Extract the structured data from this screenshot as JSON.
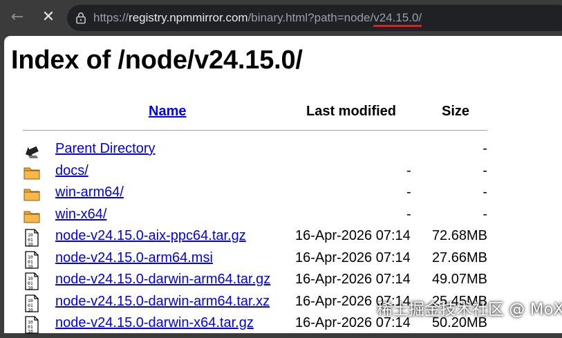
{
  "browser": {
    "back_icon": "arrow-left-icon",
    "stop_icon": "close-icon",
    "url": {
      "scheme": "https://",
      "host": "registry.npmmirror.com",
      "path": "/binary.html?path=node/",
      "highlight": "v24.15.0/"
    },
    "highlight_color": "#e02020"
  },
  "page": {
    "title": "Index of /node/v24.15.0/",
    "columns": {
      "name": "Name",
      "modified": "Last modified",
      "size": "Size"
    },
    "link_color": "#0000ee",
    "rows": [
      {
        "icon": "parent-directory-icon",
        "name": "Parent Directory",
        "modified": "",
        "size": "-"
      },
      {
        "icon": "folder-icon",
        "name": "docs/",
        "modified": "-",
        "size": "-"
      },
      {
        "icon": "folder-icon",
        "name": "win-arm64/",
        "modified": "-",
        "size": "-"
      },
      {
        "icon": "folder-icon",
        "name": "win-x64/",
        "modified": "-",
        "size": "-"
      },
      {
        "icon": "binary-file-icon",
        "name": "node-v24.15.0-aix-ppc64.tar.gz",
        "modified": "16-Apr-2026 07:14",
        "size": "72.68MB"
      },
      {
        "icon": "binary-file-icon",
        "name": "node-v24.15.0-arm64.msi",
        "modified": "16-Apr-2026 07:14",
        "size": "27.66MB"
      },
      {
        "icon": "binary-file-icon",
        "name": "node-v24.15.0-darwin-arm64.tar.gz",
        "modified": "16-Apr-2026 07:14",
        "size": "49.07MB"
      },
      {
        "icon": "binary-file-icon",
        "name": "node-v24.15.0-darwin-arm64.tar.xz",
        "modified": "16-Apr-2026 07:14",
        "size": "25.45MB"
      },
      {
        "icon": "binary-file-icon",
        "name": "node-v24.15.0-darwin-x64.tar.gz",
        "modified": "16-Apr-2026 07:14",
        "size": "50.20MB"
      }
    ]
  },
  "watermark": "稀土掘金技术社区 @ MoXC"
}
